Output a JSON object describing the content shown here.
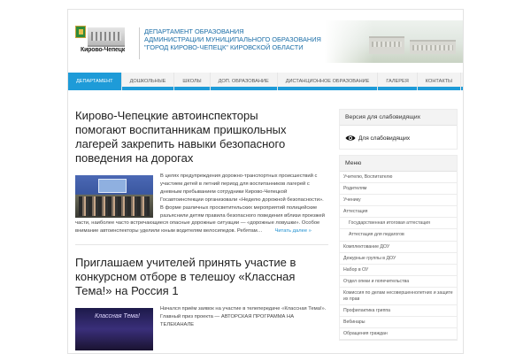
{
  "header": {
    "logo_text": "Кирово-Чепецк",
    "title_lines": [
      "Департамент образования",
      "администрации муниципального образования",
      "\"Город Кирово-Чепецк\" Кировской области"
    ]
  },
  "nav": {
    "items": [
      {
        "label": "Департамент",
        "active": true
      },
      {
        "label": "Дошкольные",
        "active": false
      },
      {
        "label": "Школы",
        "active": false
      },
      {
        "label": "Доп. образование",
        "active": false
      },
      {
        "label": "Дистанционное образование",
        "active": false
      },
      {
        "label": "Галерея",
        "active": false
      },
      {
        "label": "Контакты",
        "active": false
      }
    ]
  },
  "posts": [
    {
      "title": "Кирово-Чепецкие автоинспекторы помогают воспитанникам пришкольных лагерей   закрепить навыки безопасного поведения на дорогах",
      "excerpt": "В целях предупреждения дорожно-транспортных происшествий с участием детей в летний период для воспитанников лагерей с дневным пребыванием сотрудники Кирово-Чепецкой Госавтоинспекции организовали «Неделю дорожной безопасности». В форме различных просветительских мероприятий полицейские разъяснили детям правила безопасного поведения вблизи проезжей части, наиболее часто встречающиеся опасные дорожные ситуации — «дорожные ловушки». Особое внимание автоинспекторы уделили юным водителям велосипедов. Ребятам…",
      "read_more": "Читать далее »"
    },
    {
      "title": "Приглашаем учителей принять участие в конкурсном отборе в телешоу «Классная Тема!» на Россия 1",
      "thumb_text": "Классная Тема!",
      "excerpt": "Начался приём заявок на участие в телепередаче «Классная Тема!». Главный приз проекта — АВТОРСКАЯ ПРОГРАММА НА ТЕЛЕКАНАЛЕ",
      "read_more": ""
    }
  ],
  "sidebar": {
    "accessibility_widget": {
      "title": "Версия для слабовидящих",
      "link_label": "Для слабовидящих"
    },
    "menu_widget": {
      "title": "Меню",
      "items": [
        {
          "label": "Учителю, Воспитателю",
          "sub": false
        },
        {
          "label": "Родителям",
          "sub": false
        },
        {
          "label": "Ученику",
          "sub": false
        },
        {
          "label": "Аттестация",
          "sub": false
        },
        {
          "label": "Государственная итоговая аттестация",
          "sub": true
        },
        {
          "label": "Аттестация для педагогов",
          "sub": true
        },
        {
          "label": "Комплектование ДОУ",
          "sub": false
        },
        {
          "label": "Дежурные группы в ДОУ",
          "sub": false
        },
        {
          "label": "Набор в ОУ",
          "sub": false
        },
        {
          "label": "Отдел опеки и попечительства",
          "sub": false
        },
        {
          "label": "Комиссия по делам несовершеннолетних и защите их прав",
          "sub": false,
          "tall": true
        },
        {
          "label": "Профилактика гриппа",
          "sub": false
        },
        {
          "label": "Вебинары",
          "sub": false
        },
        {
          "label": "Обращения граждан",
          "sub": false
        }
      ]
    }
  },
  "colors": {
    "accent": "#1e9bd8",
    "title_blue": "#1d6fa8",
    "link": "#1e8fd0"
  }
}
